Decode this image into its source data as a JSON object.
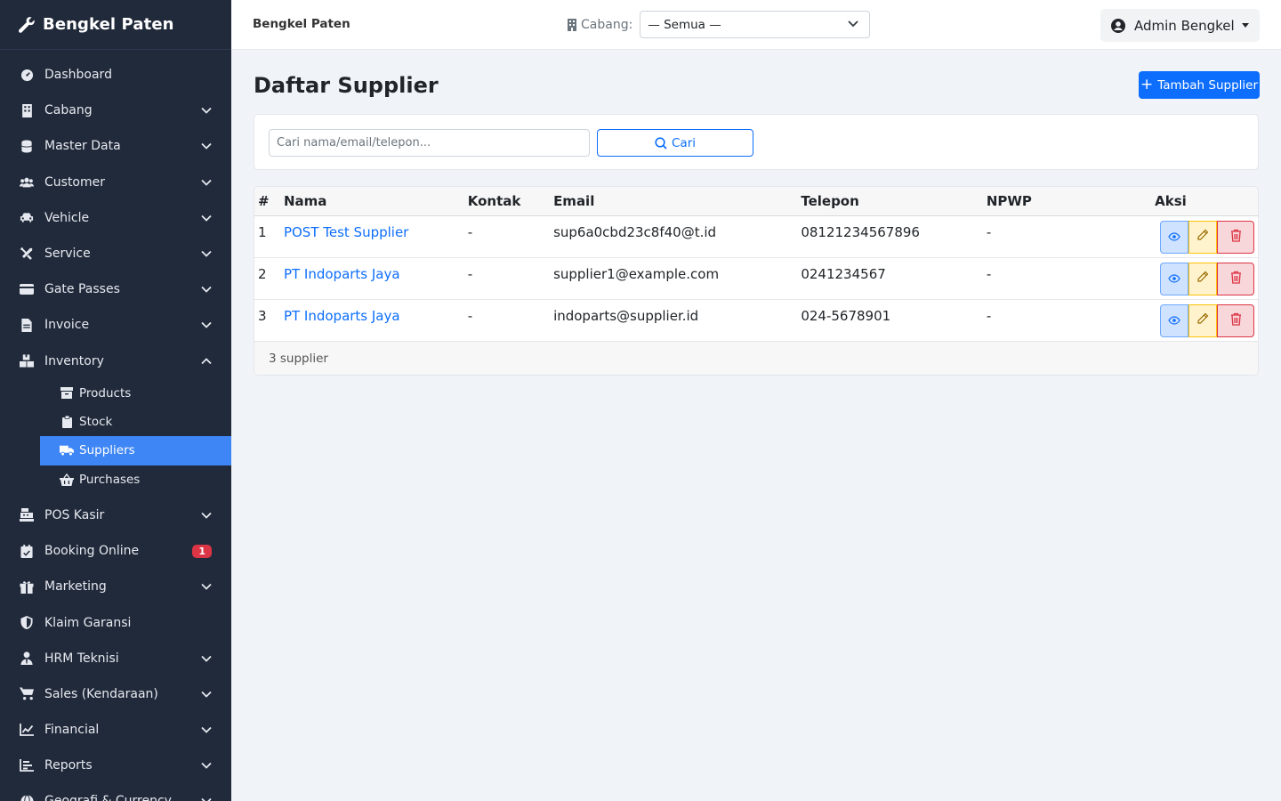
{
  "brand": "Bengkel Paten",
  "sidebar": {
    "items": [
      {
        "label": "Dashboard",
        "icon": "gauge-icon",
        "chevron": false
      },
      {
        "label": "Cabang",
        "icon": "building-icon",
        "chevron": true
      },
      {
        "label": "Master Data",
        "icon": "database-icon",
        "chevron": true
      },
      {
        "label": "Customer",
        "icon": "users-icon",
        "chevron": true
      },
      {
        "label": "Vehicle",
        "icon": "car-icon",
        "chevron": true
      },
      {
        "label": "Service",
        "icon": "tools-icon",
        "chevron": true
      },
      {
        "label": "Gate Passes",
        "icon": "id-card-icon",
        "chevron": true
      },
      {
        "label": "Invoice",
        "icon": "file-invoice-icon",
        "chevron": true
      },
      {
        "label": "Inventory",
        "icon": "boxes-icon",
        "chevron": true,
        "expanded": true
      }
    ],
    "inventory_sub": [
      {
        "label": "Products",
        "icon": "box-icon"
      },
      {
        "label": "Stock",
        "icon": "clipboard-icon"
      },
      {
        "label": "Suppliers",
        "icon": "truck-icon",
        "active": true
      },
      {
        "label": "Purchases",
        "icon": "basket-icon"
      }
    ],
    "items_after": [
      {
        "label": "POS Kasir",
        "icon": "cash-register-icon",
        "chevron": true
      },
      {
        "label": "Booking Online",
        "icon": "calendar-check-icon",
        "badge": "1"
      },
      {
        "label": "Marketing",
        "icon": "gift-icon",
        "chevron": true
      },
      {
        "label": "Klaim Garansi",
        "icon": "shield-icon",
        "chevron": false
      },
      {
        "label": "HRM Teknisi",
        "icon": "user-tie-icon",
        "chevron": true
      },
      {
        "label": "Sales (Kendaraan)",
        "icon": "cart-icon",
        "chevron": true
      },
      {
        "label": "Financial",
        "icon": "chart-line-icon",
        "chevron": true
      },
      {
        "label": "Reports",
        "icon": "chart-bar-icon",
        "chevron": true
      },
      {
        "label": "Geografi & Currency",
        "icon": "globe-icon",
        "chevron": true
      }
    ]
  },
  "topbar": {
    "app_name": "Bengkel Paten",
    "branch_label": "Cabang:",
    "branch_value": "— Semua —",
    "user_name": "Admin Bengkel"
  },
  "page": {
    "title": "Daftar Supplier",
    "add_button": "Tambah Supplier",
    "search_placeholder": "Cari nama/email/telepon...",
    "search_button": "Cari"
  },
  "table": {
    "headers": [
      "#",
      "Nama",
      "Kontak",
      "Email",
      "Telepon",
      "NPWP",
      "Aksi"
    ],
    "rows": [
      {
        "no": "1",
        "nama": "POST Test Supplier",
        "kontak": "-",
        "email": "sup6a0cbd23c8f40@t.id",
        "telepon": "08121234567896",
        "npwp": "-"
      },
      {
        "no": "2",
        "nama": "PT Indoparts Jaya",
        "kontak": "-",
        "email": "supplier1@example.com",
        "telepon": "0241234567",
        "npwp": "-"
      },
      {
        "no": "3",
        "nama": "PT Indoparts Jaya",
        "kontak": "-",
        "email": "indoparts@supplier.id",
        "telepon": "024-5678901",
        "npwp": "-"
      }
    ],
    "footer": "3 supplier"
  },
  "colors": {
    "sidebar_bg": "#212a3b",
    "active_item": "#3e86f5",
    "primary": "#0d6efd",
    "badge": "#dc3545"
  }
}
